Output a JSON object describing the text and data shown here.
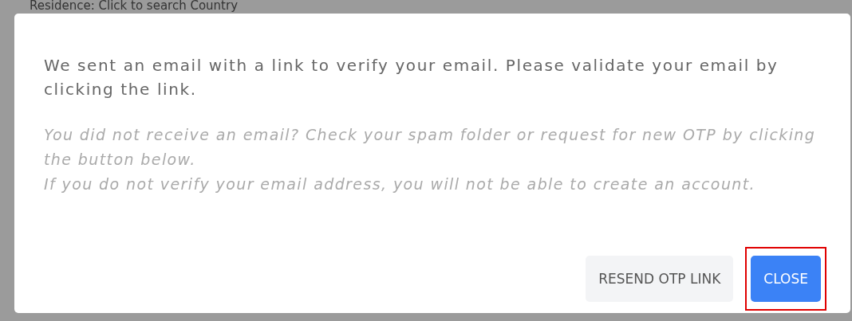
{
  "background": {
    "label": "Residence: Click to search Country"
  },
  "dialog": {
    "message": "We sent an email with a link to verify your email. Please validate your email by clicking the link.",
    "notes": [
      "You did not receive an email? Check your spam folder or request for new OTP by clicking the button below.",
      "If you do not verify your email address, you will not be able to create an account."
    ],
    "buttons": [
      {
        "label": "RESEND OTP LINK",
        "kind": "secondary",
        "highlighted": false
      },
      {
        "label": "CLOSE",
        "kind": "primary",
        "highlighted": true
      }
    ]
  }
}
